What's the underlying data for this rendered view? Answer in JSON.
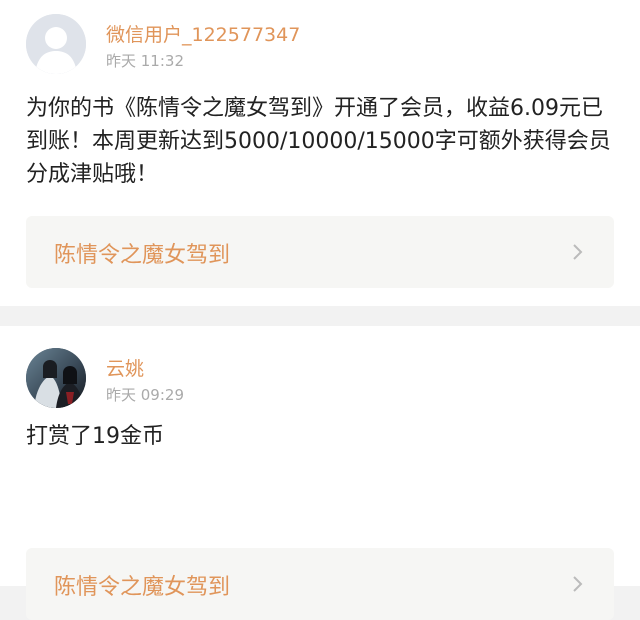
{
  "notifications": [
    {
      "username": "微信用户_122577347",
      "time": "昨天 11:32",
      "message": "为你的书《陈情令之魔女驾到》开通了会员，收益6.09元已到账！本周更新达到5000/10000/15000字可额外获得会员分成津贴哦！",
      "book_title": "陈情令之魔女驾到",
      "avatar": "default-avatar-icon"
    },
    {
      "username": "云姚",
      "time": "昨天 09:29",
      "message": "打赏了19金币",
      "book_title": "陈情令之魔女驾到",
      "avatar": "profile-photo"
    }
  ],
  "colors": {
    "accent": "#e0955a",
    "time": "#aaaaaa",
    "card_bg": "#ffffff",
    "page_bg": "#f2f2f2",
    "link_bg": "#f6f6f4"
  }
}
